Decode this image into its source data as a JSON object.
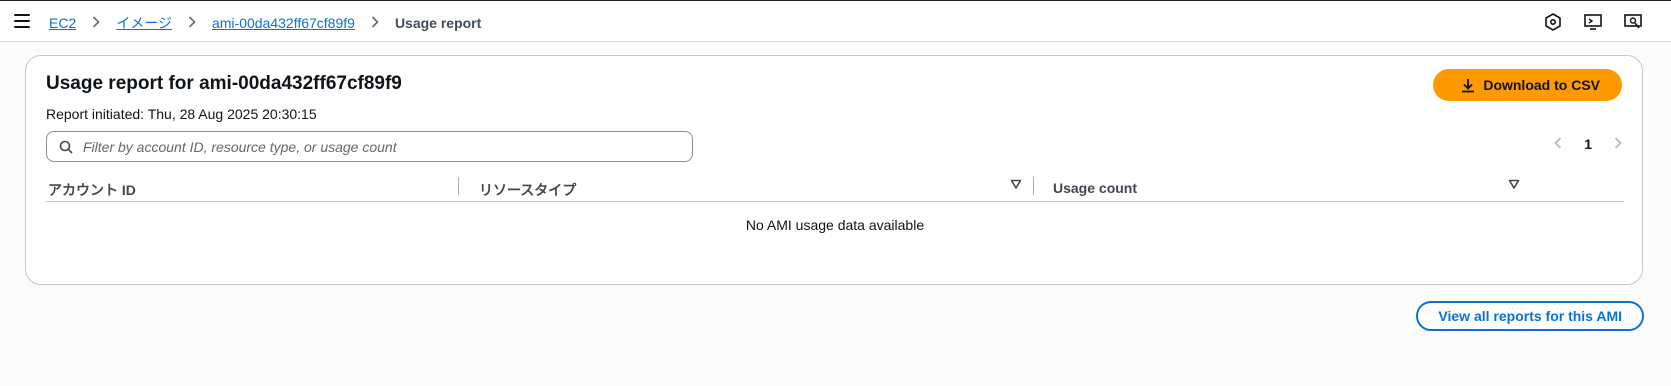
{
  "breadcrumb": {
    "items": [
      "EC2",
      "イメージ",
      "ami-00da432ff67cf89f9"
    ],
    "current": "Usage report"
  },
  "report": {
    "title": "Usage report for ami-00da432ff67cf89f9",
    "initiated": "Report initiated: Thu, 28 Aug 2025 20:30:15",
    "download_label": "Download to CSV",
    "filter_placeholder": "Filter by account ID, resource type, or usage count",
    "page": "1",
    "columns": [
      "アカウント ID",
      "リソースタイプ",
      "Usage count"
    ],
    "empty_message": "No AMI usage data available"
  },
  "footer": {
    "view_all_label": "View all reports for this AMI"
  },
  "colors": {
    "accent": "#ff9900",
    "link": "#0972d3"
  },
  "icons": [
    "menu-icon",
    "chevron-right-icon",
    "notifications-icon",
    "cloudshell-icon",
    "feedback-icon",
    "download-icon",
    "search-icon",
    "chevron-left-icon",
    "sort-icon"
  ]
}
